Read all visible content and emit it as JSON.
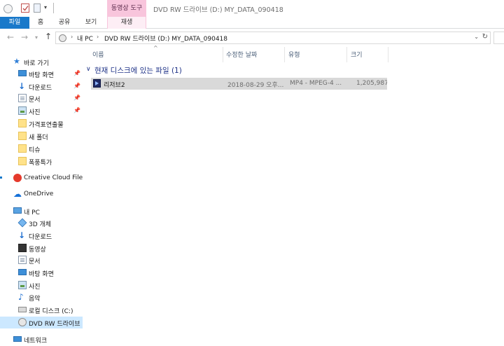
{
  "titlebar": {
    "tool_tab": "동영상 도구",
    "title": "DVD RW 드라이브 (D:) MY_DATA_090418"
  },
  "ribbon": {
    "tabs": [
      "파일",
      "홈",
      "공유",
      "보기",
      "재생"
    ]
  },
  "address": {
    "segments": [
      "내 PC",
      "DVD RW 드라이브 (D:) MY_DATA_090418"
    ],
    "back_icon": "left-arrow",
    "forward_icon": "right-arrow",
    "up_icon": "up-arrow",
    "refresh_icon": "refresh"
  },
  "nav": {
    "quick_access": "바로 가기",
    "pinned": [
      {
        "label": "바탕 화면",
        "icon": "desktop-icon"
      },
      {
        "label": "다운로드",
        "icon": "download-icon"
      },
      {
        "label": "문서",
        "icon": "document-icon"
      },
      {
        "label": "사진",
        "icon": "pictures-icon"
      }
    ],
    "folders": [
      "가격표연출물",
      "새 폴더",
      "티슈",
      "폭풍특가"
    ],
    "creative_cloud": "Creative Cloud Files",
    "onedrive": "OneDrive",
    "this_pc": "내 PC",
    "pc_items": [
      {
        "label": "3D 개체",
        "icon": "3d-objects-icon"
      },
      {
        "label": "다운로드",
        "icon": "download-icon"
      },
      {
        "label": "동영상",
        "icon": "videos-icon"
      },
      {
        "label": "문서",
        "icon": "document-icon"
      },
      {
        "label": "바탕 화면",
        "icon": "desktop-icon"
      },
      {
        "label": "사진",
        "icon": "pictures-icon"
      },
      {
        "label": "음악",
        "icon": "music-icon"
      },
      {
        "label": "로컬 디스크 (C:)",
        "icon": "local-disk-icon"
      },
      {
        "label": "DVD RW 드라이브",
        "icon": "dvd-drive-icon"
      }
    ],
    "network": "네트워크"
  },
  "filelist": {
    "columns": [
      "이름",
      "수정한 날짜",
      "유형",
      "크기"
    ],
    "group_header": "현재 디스크에 있는 파일 (1)",
    "rows": [
      {
        "name": "리저브2",
        "modified": "2018-08-29 오후...",
        "type": "MP4 - MPEG-4 ...",
        "size": "1,205,987"
      }
    ]
  },
  "colors": {
    "file_tab": "#1979ca",
    "video_tools_tab": "#f8c5dc",
    "selected_nav": "#cce8ff",
    "group_header": "#1e3287"
  }
}
